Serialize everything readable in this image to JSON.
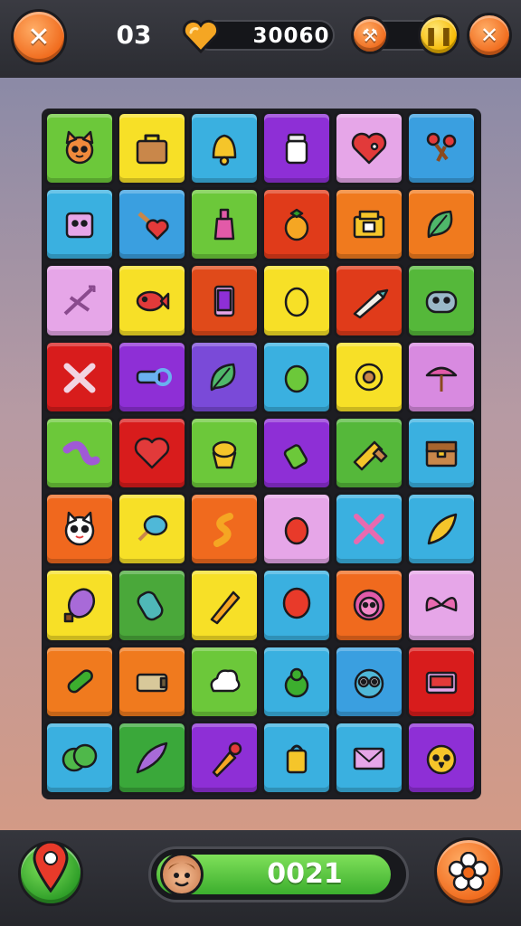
{
  "hud": {
    "level": "03",
    "score": "30060",
    "close_icon": "close-x-icon",
    "heart_icon": "heart-icon",
    "hammer_icon": "hammer-icon",
    "pause_icon": "pause-icon",
    "exit_icon": "close-x-icon"
  },
  "board": {
    "rows": 9,
    "cols": 6,
    "tiles": [
      [
        "cat",
        "bag",
        "bell",
        "jar",
        "heart-bird",
        "keys"
      ],
      [
        "cube",
        "heart-wand",
        "potion",
        "fruit",
        "box",
        "leaf"
      ],
      [
        "arrows",
        "fish",
        "phone",
        "egg",
        "pen",
        "fish-face"
      ],
      [
        "cross",
        "scope",
        "leaf",
        "bean",
        "tape",
        "umbrella"
      ],
      [
        "worm",
        "heart",
        "cupcake",
        "bottle",
        "knife",
        "chest"
      ],
      [
        "cat-face",
        "cotton",
        "swirl",
        "drop",
        "sticks",
        "leaf-gold"
      ],
      [
        "eggplant",
        "tube",
        "pencil",
        "balloon",
        "lion",
        "wings"
      ],
      [
        "cucumber",
        "battery",
        "cloud",
        "pear",
        "owl",
        "radio"
      ],
      [
        "bush",
        "feather",
        "dropper",
        "lantern",
        "envelope",
        "bird-face"
      ]
    ],
    "colors": [
      [
        "#6cc83a",
        "#f7e027",
        "#3ab0e0",
        "#8e2fd6",
        "#e6a6e8",
        "#3a9fe0"
      ],
      [
        "#3ab0e0",
        "#3a9fe0",
        "#6cc83a",
        "#e03b1a",
        "#f07a1e",
        "#f07a1e"
      ],
      [
        "#e6a6e8",
        "#f7e027",
        "#e04a1a",
        "#f7e027",
        "#e03b1a",
        "#55b83a"
      ],
      [
        "#d81c1c",
        "#8e2fd6",
        "#7a4ad8",
        "#3ab0e0",
        "#f7e027",
        "#d88ae0"
      ],
      [
        "#6cc83a",
        "#d81c1c",
        "#6cc83a",
        "#8e2fd6",
        "#55b83a",
        "#3ab0e0"
      ],
      [
        "#f0681e",
        "#f7e027",
        "#f06a1e",
        "#e6a6e8",
        "#3ab0e0",
        "#3ab0e0"
      ],
      [
        "#f7e027",
        "#4aa83a",
        "#f7e027",
        "#3ab0e0",
        "#f06a1e",
        "#e6a6e8"
      ],
      [
        "#f07a1e",
        "#f07a1e",
        "#6cc83a",
        "#3ab0e0",
        "#3a9fe0",
        "#d81c1c"
      ],
      [
        "#3ab0e0",
        "#3aa83a",
        "#8e2fd6",
        "#3ab0e0",
        "#3ab0e0",
        "#8e2fd6"
      ]
    ]
  },
  "footer": {
    "map_pin_icon": "map-pin-icon",
    "counter": "0021",
    "avatar_icon": "player-avatar-icon",
    "progress": 0.96,
    "settings_icon": "gear-flower-icon"
  }
}
